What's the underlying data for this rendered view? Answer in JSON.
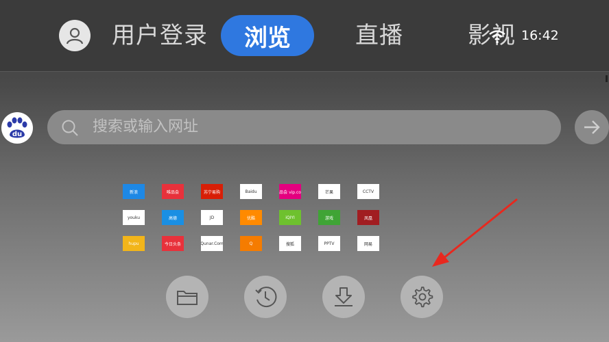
{
  "header": {
    "nav": [
      {
        "label": "用户登录",
        "active": false
      },
      {
        "label": "浏览",
        "active": true
      },
      {
        "label": "直播",
        "active": false
      },
      {
        "label": "影视",
        "active": false
      }
    ],
    "clock": "16:42",
    "active_color": "#2f78e0"
  },
  "search": {
    "engine_icon": "baidu-paw-icon",
    "engine_text": "du",
    "placeholder": "搜索或输入网址"
  },
  "shortcuts": [
    {
      "label": "新浪",
      "bg": "#1e88e5",
      "light": false
    },
    {
      "label": "唯品会",
      "bg": "#e8313b",
      "light": false
    },
    {
      "label": "苏宁易购",
      "bg": "#d81e06",
      "light": false
    },
    {
      "label": "Baidu",
      "bg": "#ffffff",
      "light": true
    },
    {
      "label": "唯品会 vip.com",
      "bg": "#e4007f",
      "light": false
    },
    {
      "label": "芒果",
      "bg": "#ffffff",
      "light": true
    },
    {
      "label": "CCTV",
      "bg": "#ffffff",
      "light": true
    },
    {
      "label": "youku",
      "bg": "#ffffff",
      "light": true
    },
    {
      "label": "高德",
      "bg": "#1a8fe3",
      "light": false
    },
    {
      "label": "JD",
      "bg": "#ffffff",
      "light": true
    },
    {
      "label": "优酷",
      "bg": "#ff8a00",
      "light": false
    },
    {
      "label": "iQIYI",
      "bg": "#6ec12e",
      "light": false
    },
    {
      "label": "游戏",
      "bg": "#3fa435",
      "light": false
    },
    {
      "label": "凤凰",
      "bg": "#a11d21",
      "light": false
    },
    {
      "label": "hupu",
      "bg": "#f2b51a",
      "light": false
    },
    {
      "label": "今日头条",
      "bg": "#e8313b",
      "light": false
    },
    {
      "label": "Qunar.Com",
      "bg": "#ffffff",
      "light": true
    },
    {
      "label": "Q",
      "bg": "#f57c00",
      "light": false
    },
    {
      "label": "搜狐",
      "bg": "#ffffff",
      "light": true
    },
    {
      "label": "PPTV",
      "bg": "#ffffff",
      "light": true
    },
    {
      "label": "网易",
      "bg": "#ffffff",
      "light": true
    }
  ],
  "bottom_buttons": [
    {
      "name": "bookmarks-button",
      "icon": "folder-icon"
    },
    {
      "name": "history-button",
      "icon": "clock-history-icon"
    },
    {
      "name": "download-button",
      "icon": "download-icon"
    },
    {
      "name": "settings-button",
      "icon": "gear-icon"
    }
  ],
  "annotation": {
    "color": "#e8281e"
  }
}
